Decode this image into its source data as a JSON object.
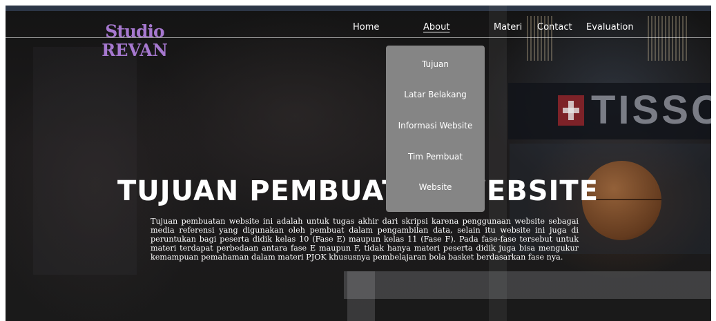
{
  "logo": {
    "line1": "Studio",
    "line2": "REVAN",
    "color": "#a678cf"
  },
  "nav": {
    "items": [
      "Home",
      "About",
      "Materi",
      "Contact",
      "Evaluation"
    ],
    "active": "About"
  },
  "dropdown": {
    "items": [
      "Tujuan",
      "Latar Belakang",
      "Informasi Website",
      "Tim Pembuat",
      "Website"
    ],
    "background": "#858585"
  },
  "hero": {
    "title": "TUJUAN PEMBUATAN WEBSITE",
    "paragraph": "Tujuan pembuatan website ini adalah untuk tugas akhir dari skripsi karena penggunaan website sebagai media referensi yang digunakan oleh pembuat dalam pengambilan data, selain itu website ini juga di peruntukan bagi peserta didik kelas 10 (Fase E) maupun kelas 11 (Fase F). Pada fase-fase tersebut untuk materi terdapat perbedaan antara fase E maupun F, tidak hanya materi peserta didik juga bisa mengukur kemampuan pemahaman dalam materi PJOK khususnya pembelajaran bola basket berdasarkan fase nya."
  },
  "background": {
    "brand_text": "TISSO"
  }
}
